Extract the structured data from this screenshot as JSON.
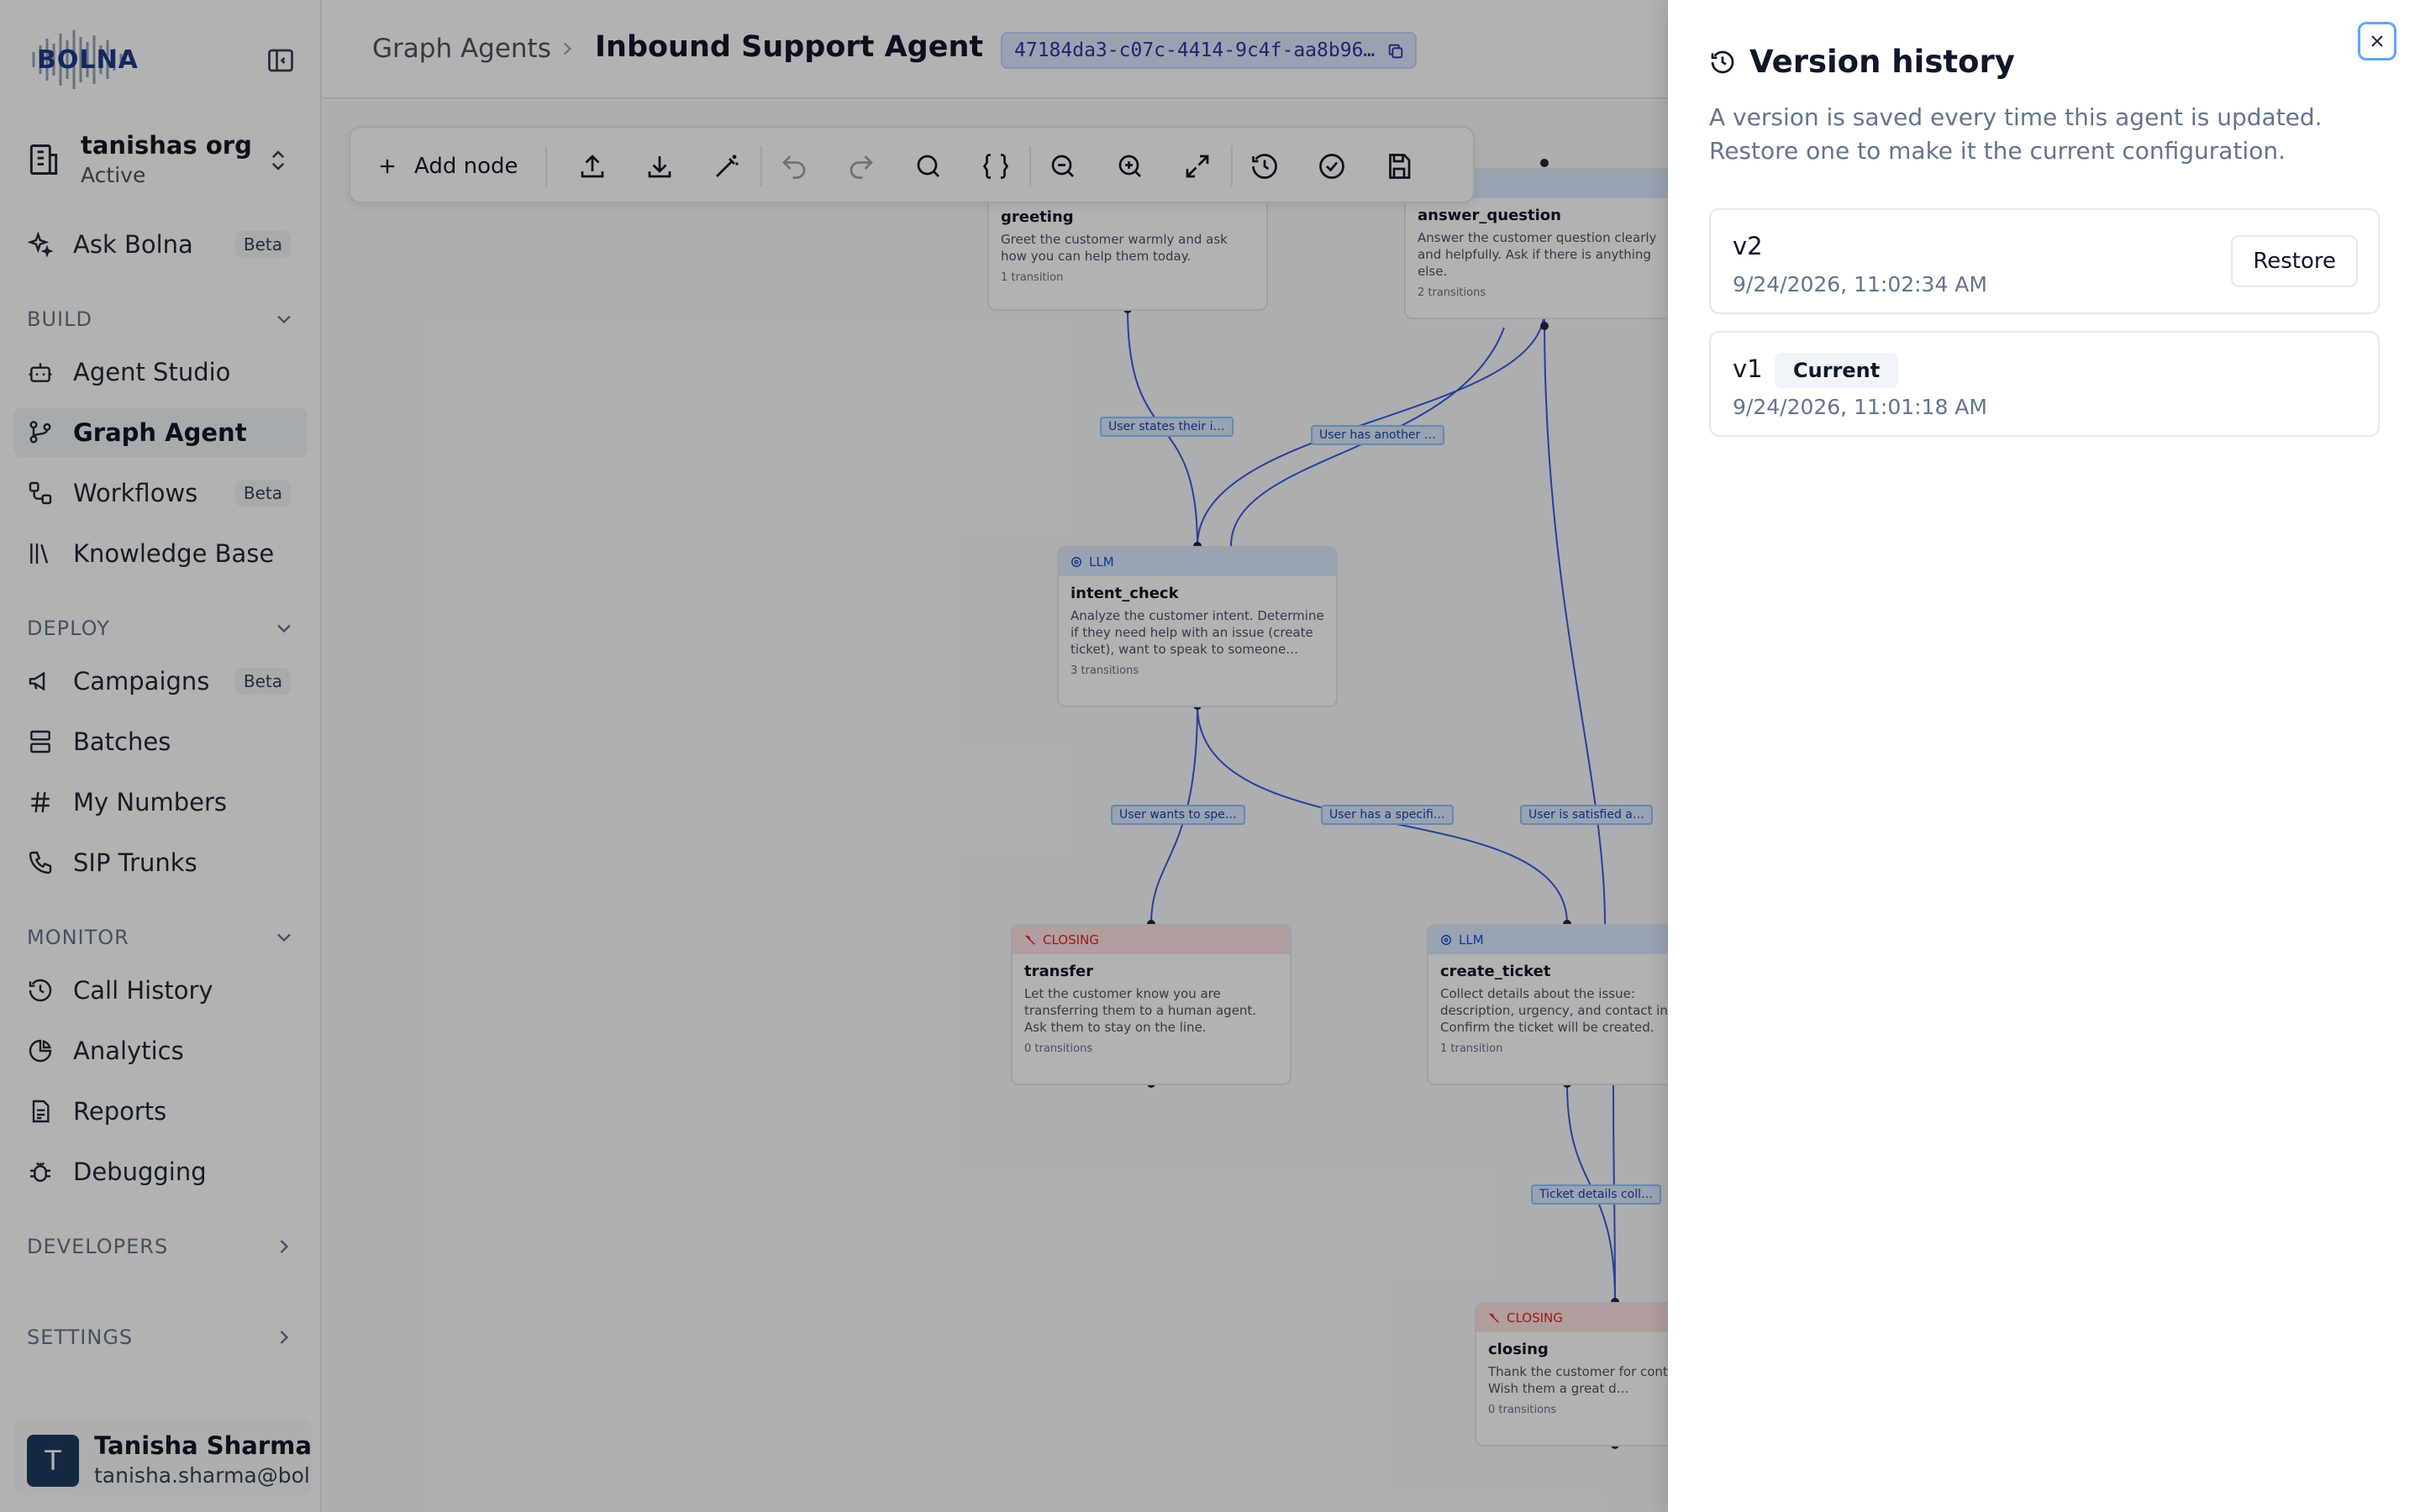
{
  "app": {
    "logo_text": "BOLNA"
  },
  "org": {
    "name": "tanishas org",
    "status": "Active"
  },
  "sidebar": {
    "ask": {
      "label": "Ask Bolna",
      "badge": "Beta"
    },
    "build_label": "BUILD",
    "build_items": [
      {
        "label": "Agent Studio"
      },
      {
        "label": "Graph Agent"
      },
      {
        "label": "Workflows",
        "badge": "Beta"
      },
      {
        "label": "Knowledge Base"
      }
    ],
    "deploy_label": "DEPLOY",
    "deploy_items": [
      {
        "label": "Campaigns",
        "badge": "Beta"
      },
      {
        "label": "Batches"
      },
      {
        "label": "My Numbers"
      },
      {
        "label": "SIP Trunks"
      }
    ],
    "monitor_label": "MONITOR",
    "monitor_items": [
      {
        "label": "Call History"
      },
      {
        "label": "Analytics"
      },
      {
        "label": "Reports"
      },
      {
        "label": "Debugging"
      }
    ],
    "developers_label": "DEVELOPERS",
    "settings_label": "SETTINGS"
  },
  "user": {
    "initial": "T",
    "name": "Tanisha Sharma",
    "email": "tanisha.sharma@bolna.ai"
  },
  "header": {
    "breadcrumb_root": "Graph Agents",
    "breadcrumb_current": "Inbound Support Agent",
    "agent_id": "47184da3-c07c-4414-9c4f-aa8b96…"
  },
  "toolbar": {
    "add_node_label": "Add node"
  },
  "graph": {
    "nodes": {
      "greeting": {
        "title": "greeting",
        "desc": "Greet the customer warmly and ask how you can help them today.",
        "transitions": "1 transition"
      },
      "answer_question": {
        "title": "answer_question",
        "desc": "Answer the customer question clearly and helpfully. Ask if there is anything else.",
        "transitions": "2 transitions"
      },
      "intent_check": {
        "type": "LLM",
        "title": "intent_check",
        "desc": "Analyze the customer intent. Determine if they need help with an issue (create ticket), want to speak to someone…",
        "transitions": "3 transitions"
      },
      "transfer": {
        "type": "CLOSING",
        "title": "transfer",
        "desc": "Let the customer know you are transferring them to a human agent. Ask them to stay on the line.",
        "transitions": "0 transitions"
      },
      "create_ticket": {
        "type": "LLM",
        "title": "create_ticket",
        "desc": "Collect details about the issue: description, urgency, and contact in… Confirm the ticket will be created.",
        "transitions": "1 transition"
      },
      "closing": {
        "type": "CLOSING",
        "title": "closing",
        "desc": "Thank the customer for cont… support. Wish them a great d…",
        "transitions": "0 transitions"
      }
    },
    "edges": {
      "e1": "User states their i…",
      "e2": "User has another …",
      "e3": "User wants to spe…",
      "e4": "User has a specifi…",
      "e5": "User is satisfied a…",
      "e6": "Ticket details coll…"
    }
  },
  "panel": {
    "title": "Version history",
    "description": "A version is saved every time this agent is updated. Restore one to make it the current configuration.",
    "versions": [
      {
        "label": "v2",
        "date": "9/24/2026, 11:02:34 AM",
        "action": "Restore"
      },
      {
        "label": "v1",
        "badge": "Current",
        "date": "9/24/2026, 11:01:18 AM"
      }
    ]
  },
  "colors": {
    "accent": "#1d4ed8",
    "llm": "#dbeafe",
    "closing": "#fee2e2",
    "overlay": "rgba(0,0,0,0.30)"
  }
}
